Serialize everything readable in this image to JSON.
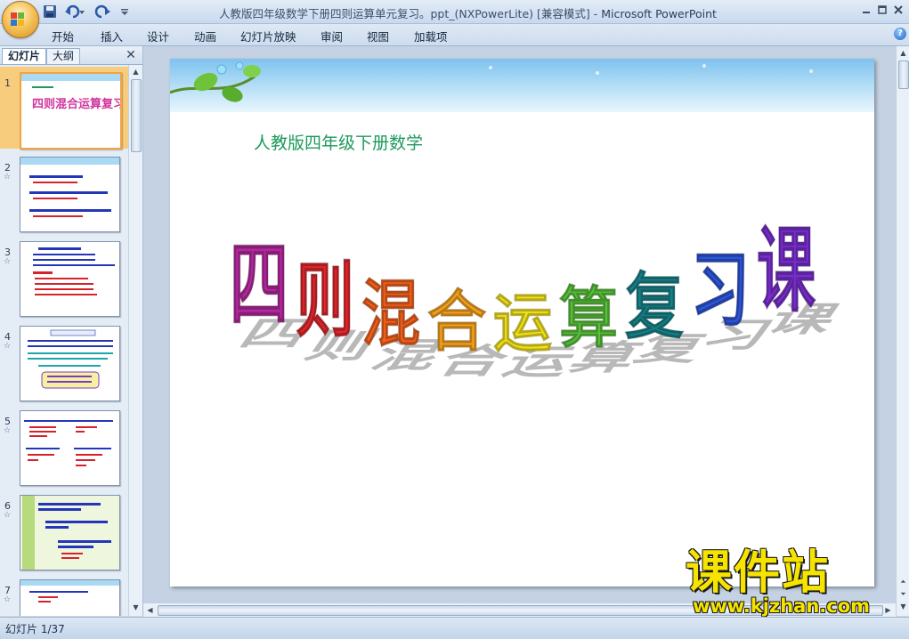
{
  "window": {
    "title": "人教版四年级数学下册四则运算单元复习。ppt_(NXPowerLite) [兼容模式]",
    "app_name": "Microsoft PowerPoint",
    "separator": " - "
  },
  "ribbon": {
    "tabs": [
      "开始",
      "插入",
      "设计",
      "动画",
      "幻灯片放映",
      "审阅",
      "视图",
      "加载项"
    ]
  },
  "left_panel": {
    "tab_slides": "幻灯片",
    "tab_outline": "大纲",
    "close_glyph": "✕",
    "slides": [
      {
        "number": "1",
        "title": "四则混合运算复习课",
        "selected": true
      },
      {
        "number": "2",
        "star": "☆"
      },
      {
        "number": "3",
        "star": "☆"
      },
      {
        "number": "4",
        "star": "☆"
      },
      {
        "number": "5",
        "star": "☆"
      },
      {
        "number": "6",
        "star": "☆"
      },
      {
        "number": "7",
        "star": "☆"
      }
    ]
  },
  "slide": {
    "subtitle": "人教版四年级下册数学",
    "title": "四则混合运算复习课",
    "title_chars": [
      "四",
      "则",
      "混",
      "合",
      "运",
      "算",
      "复",
      "习",
      "课"
    ],
    "title_colors": [
      "#b4289e",
      "#e2262c",
      "#f5601b",
      "#f6a21c",
      "#f2e21a",
      "#58c23a",
      "#17838a",
      "#2c55d8",
      "#7a2ed0"
    ]
  },
  "watermark": {
    "main": "课件站",
    "url": "www.kjzhan.com"
  },
  "status": {
    "slide_counter": "幻灯片 1/37"
  },
  "icons": {
    "office": "office-logo-icon",
    "save": "save-icon",
    "undo": "undo-icon",
    "redo": "redo-icon",
    "help": "help-icon"
  }
}
